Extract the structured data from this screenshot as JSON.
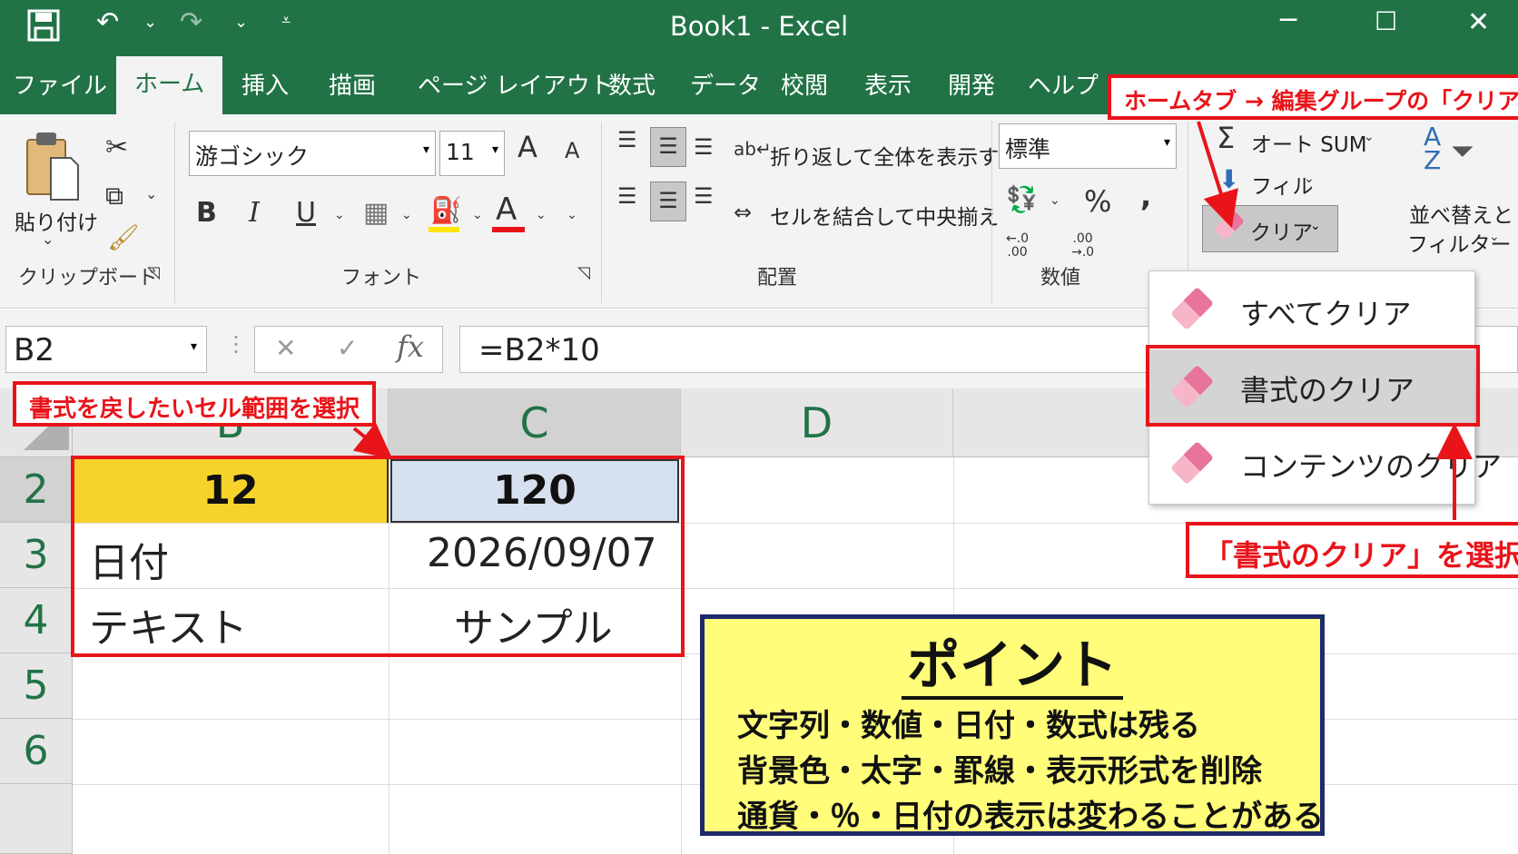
{
  "titlebar": {
    "title": "Book1  -  Excel",
    "icons": [
      "save-icon",
      "undo-icon",
      "redo-icon",
      "customize-qat-icon",
      "minimize-icon",
      "maximize-icon",
      "close-icon"
    ]
  },
  "tabs": [
    "ファイル",
    "ホーム",
    "挿入",
    "描画",
    "ページ レイアウト",
    "数式",
    "データ",
    "校閲",
    "表示",
    "開発",
    "ヘルプ"
  ],
  "ribbon": {
    "clipboard": {
      "paste_label": "貼り付け",
      "group_label": "クリップボード"
    },
    "font": {
      "font_name": "游ゴシック",
      "font_size": "11",
      "group_label": "フォント",
      "bold": "B",
      "italic": "I",
      "underline": "U",
      "grow": "A",
      "shrink": "A",
      "font_color_letter": "A",
      "fill_color": "#ffe600",
      "font_color": "#e8141a"
    },
    "alignment": {
      "wrap_label": "折り返して全体を表示する",
      "merge_label": "セルを結合して中央揃え",
      "group_label": "配置"
    },
    "number": {
      "format": "標準",
      "percent": "%",
      "comma": ",",
      "inc_decimal": "←.0\n.00",
      "dec_decimal": ".00\n→.0",
      "group_label": "数値"
    },
    "editing": {
      "autosum_label": "オート SUM",
      "fill_label": "フィル",
      "clear_label": "クリア",
      "sort_label_line1": "並べ替えと",
      "sort_label_line2": "フィルター"
    }
  },
  "formula_bar": {
    "name_box": "B2",
    "cancel": "✕",
    "enter": "✓",
    "fx": "fx",
    "formula": "=B2*10"
  },
  "grid": {
    "columns": [
      "B",
      "C",
      "D"
    ],
    "rows": [
      "2",
      "3",
      "4",
      "5",
      "6"
    ],
    "cells": {
      "B2": "12",
      "C2": "120",
      "B3": "日付",
      "C3": "2026/09/07",
      "B4": "テキスト",
      "C4": "サンプル"
    },
    "colors": {
      "B2_fill": "#f6d32a",
      "C2_fill": "#d6e0ee"
    }
  },
  "dropdown": {
    "items": [
      "すべてクリア",
      "書式のクリア",
      "コンテンツのクリア"
    ],
    "selected": "書式のクリア"
  },
  "annotations": {
    "top_callout": "ホームタブ → 編集グループの「クリア」",
    "left_callout": "書式を戻したいセル範囲を選択",
    "right_callout": "「書式のクリア」を選択"
  },
  "point_box": {
    "title": "ポイント",
    "lines": [
      "文字列・数値・日付・数式は残る",
      "背景色・太字・罫線・表示形式を削除",
      "通貨・％・日付の表示は変わることがある"
    ]
  },
  "accent_colors": {
    "excel_green": "#217346",
    "annotation_red": "#e8141a",
    "point_bg": "#fffd7a",
    "point_border": "#1f2a6b"
  }
}
